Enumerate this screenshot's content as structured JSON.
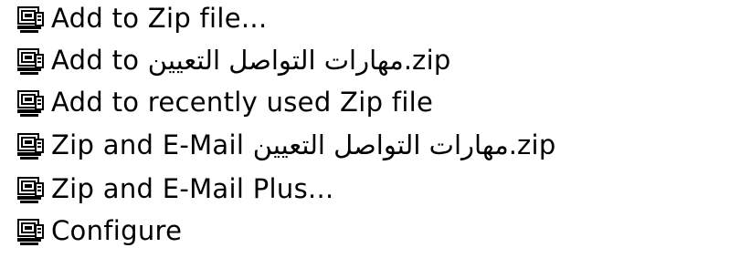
{
  "context_menu": {
    "items": [
      {
        "label": "Add to Zip file...",
        "icon": "winzip-icon"
      },
      {
        "label": "Add to مهارات التواصل التعيين.zip",
        "icon": "winzip-icon"
      },
      {
        "label": "Add to recently used Zip file",
        "icon": "winzip-icon"
      },
      {
        "label": "Zip and E-Mail مهارات التواصل التعيين.zip",
        "icon": "winzip-icon"
      },
      {
        "label": "Zip and E-Mail Plus...",
        "icon": "winzip-icon"
      },
      {
        "label": "Configure",
        "icon": "winzip-icon"
      }
    ]
  }
}
